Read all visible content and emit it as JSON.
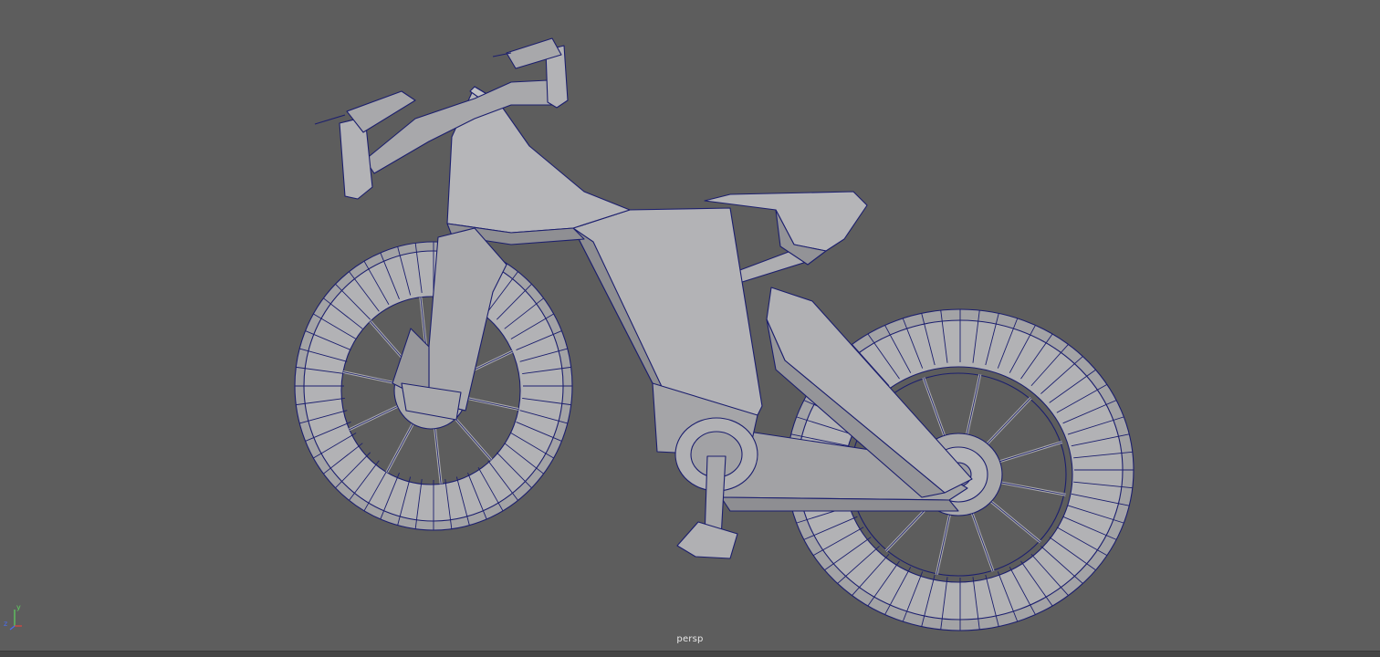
{
  "viewport": {
    "camera_name": "persp",
    "background_color": "#5d5d5d",
    "wire_color": "#1c1f6e",
    "mesh_color": "#a9a9ab"
  },
  "axis_gizmo": {
    "y_label": "y",
    "x_label": "x",
    "z_label": "z",
    "x_color": "#e0443f",
    "y_color": "#5fd35f",
    "z_color": "#4a6cf0"
  },
  "scene": {
    "object": "bicycle-wireframe-model"
  }
}
